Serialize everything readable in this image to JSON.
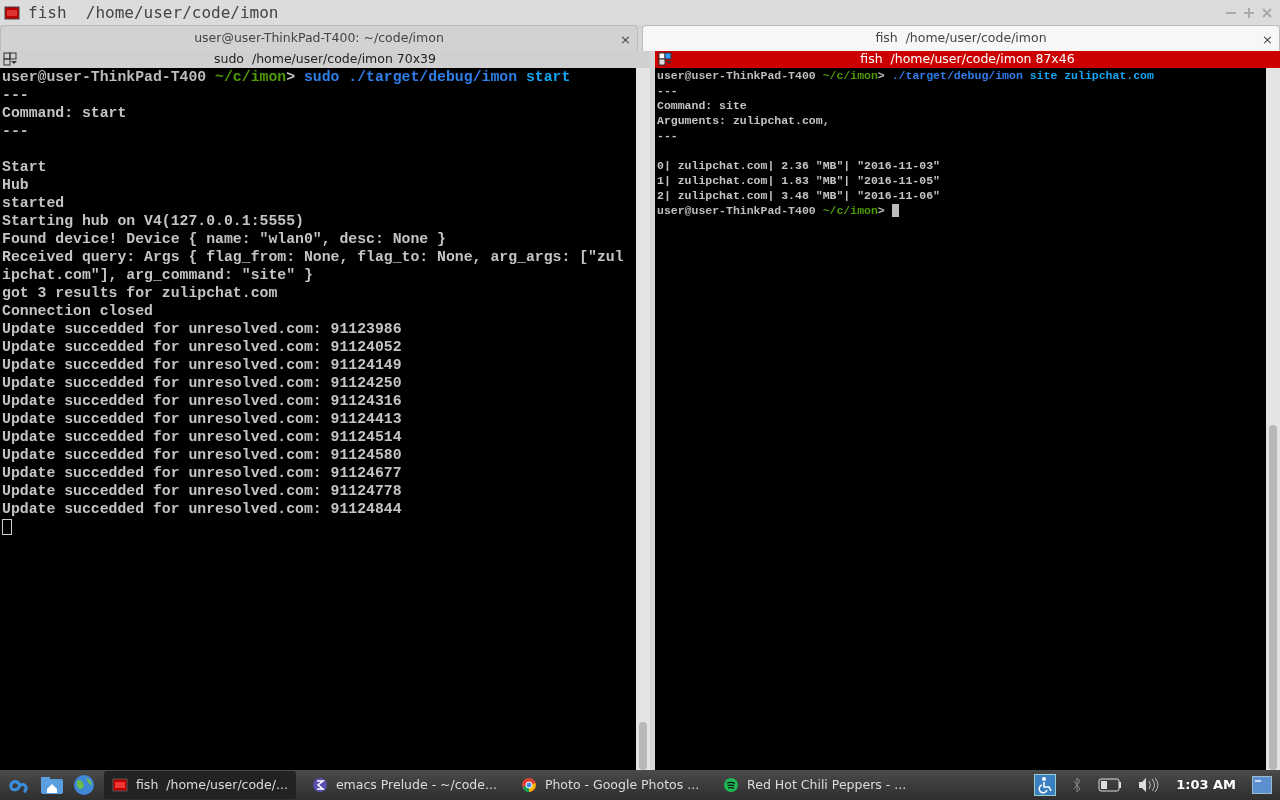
{
  "window": {
    "title": "fish  /home/user/code/imon"
  },
  "tabs": [
    {
      "label": "user@user-ThinkPad-T400: ~/code/imon",
      "selected": false,
      "close": "×"
    },
    {
      "label": "fish  /home/user/code/imon",
      "selected": true,
      "close": "×"
    }
  ],
  "panes": [
    {
      "title": "sudo  /home/user/code/imon 70x39",
      "focused": false,
      "lines": [
        [
          {
            "kind": "user",
            "text": "user@user-ThinkPad-T400"
          },
          {
            "kind": "path",
            "text": " ~/c/imon"
          },
          {
            "kind": "plain",
            "text": "> "
          },
          {
            "kind": "cmd",
            "text": "sudo ./target/debug/imon"
          },
          {
            "kind": "arg",
            "text": " start"
          }
        ],
        [
          {
            "kind": "plain",
            "text": "---"
          }
        ],
        [
          {
            "kind": "plain",
            "text": "Command: start"
          }
        ],
        [
          {
            "kind": "plain",
            "text": "---"
          }
        ],
        {
          "kind": "blank"
        },
        [
          {
            "kind": "plain",
            "text": "Start"
          }
        ],
        [
          {
            "kind": "plain",
            "text": "Hub"
          }
        ],
        [
          {
            "kind": "plain",
            "text": "started"
          }
        ],
        [
          {
            "kind": "plain",
            "text": "Starting hub on V4(127.0.0.1:5555)"
          }
        ],
        [
          {
            "kind": "plain",
            "text": "Found device! Device { name: \"wlan0\", desc: None }"
          }
        ],
        [
          {
            "kind": "plain",
            "text": "Received query: Args { flag_from: None, flag_to: None, arg_args: [\"zul"
          }
        ],
        [
          {
            "kind": "plain",
            "text": "ipchat.com\"], arg_command: \"site\" }"
          }
        ],
        [
          {
            "kind": "plain",
            "text": "got 3 results for zulipchat.com"
          }
        ],
        [
          {
            "kind": "plain",
            "text": "Connection closed"
          }
        ],
        [
          {
            "kind": "plain",
            "text": "Update succedded for unresolved.com: 91123986"
          }
        ],
        [
          {
            "kind": "plain",
            "text": "Update succedded for unresolved.com: 91124052"
          }
        ],
        [
          {
            "kind": "plain",
            "text": "Update succedded for unresolved.com: 91124149"
          }
        ],
        [
          {
            "kind": "plain",
            "text": "Update succedded for unresolved.com: 91124250"
          }
        ],
        [
          {
            "kind": "plain",
            "text": "Update succedded for unresolved.com: 91124316"
          }
        ],
        [
          {
            "kind": "plain",
            "text": "Update succedded for unresolved.com: 91124413"
          }
        ],
        [
          {
            "kind": "plain",
            "text": "Update succedded for unresolved.com: 91124514"
          }
        ],
        [
          {
            "kind": "plain",
            "text": "Update succedded for unresolved.com: 91124580"
          }
        ],
        [
          {
            "kind": "plain",
            "text": "Update succedded for unresolved.com: 91124677"
          }
        ],
        [
          {
            "kind": "plain",
            "text": "Update succedded for unresolved.com: 91124778"
          }
        ],
        [
          {
            "kind": "plain",
            "text": "Update succedded for unresolved.com: 91124844"
          }
        ]
      ]
    },
    {
      "title": "fish  /home/user/code/imon 87x46",
      "focused": true,
      "lines": [
        [
          {
            "kind": "user",
            "text": "user@user-ThinkPad-T400"
          },
          {
            "kind": "path",
            "text": " ~/c/imon"
          },
          {
            "kind": "plain",
            "text": "> "
          },
          {
            "kind": "cmd",
            "text": "./target/debug/imon"
          },
          {
            "kind": "arg",
            "text": " site zulipchat.com"
          }
        ],
        [
          {
            "kind": "plain",
            "text": "---"
          }
        ],
        [
          {
            "kind": "plain",
            "text": "Command: site"
          }
        ],
        [
          {
            "kind": "plain",
            "text": "Arguments: zulipchat.com,"
          }
        ],
        [
          {
            "kind": "plain",
            "text": "---"
          }
        ],
        {
          "kind": "blank"
        },
        [
          {
            "kind": "plain",
            "text": "0| zulipchat.com| 2.36 \"MB\"| \"2016-11-03\""
          }
        ],
        [
          {
            "kind": "plain",
            "text": "1| zulipchat.com| 1.83 \"MB\"| \"2016-11-05\""
          }
        ],
        [
          {
            "kind": "plain",
            "text": "2| zulipchat.com| 3.48 \"MB\"| \"2016-11-06\""
          }
        ],
        [
          {
            "kind": "user",
            "text": "user@user-ThinkPad-T400"
          },
          {
            "kind": "path",
            "text": " ~/c/imon"
          },
          {
            "kind": "plain",
            "text": "> "
          }
        ]
      ]
    }
  ],
  "taskbar": {
    "tasks": [
      {
        "label": "fish  /home/user/code/...",
        "selected": true
      },
      {
        "label": "emacs Prelude - ~/code...",
        "selected": false
      },
      {
        "label": "Photo - Google Photos ...",
        "selected": false
      },
      {
        "label": "Red Hot Chili Peppers - ...",
        "selected": false
      }
    ],
    "clock": "1:03 AM"
  }
}
